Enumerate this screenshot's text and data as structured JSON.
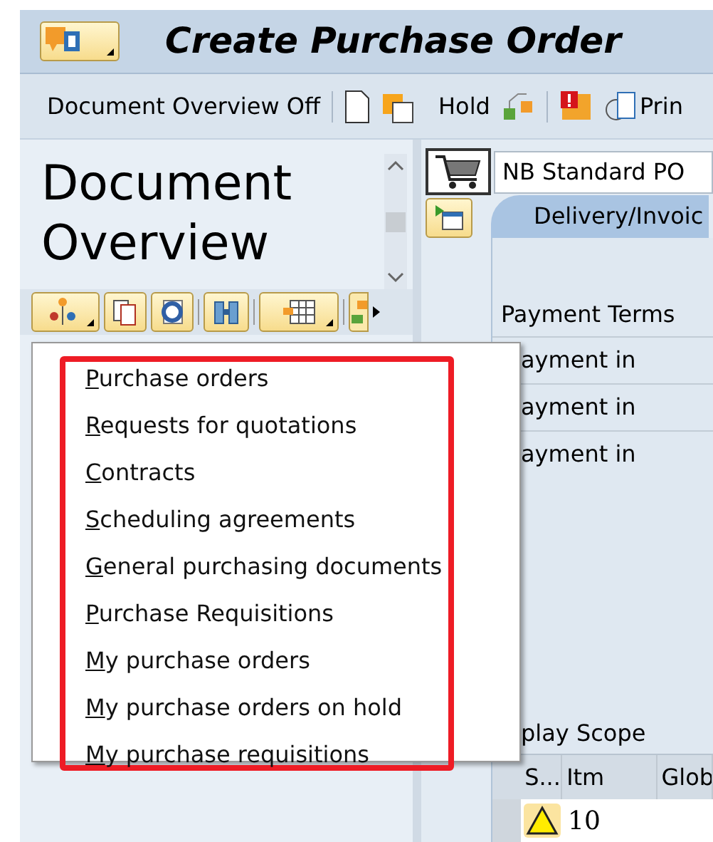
{
  "window": {
    "title": "Create Purchase Order"
  },
  "toolbar": {
    "labels": [
      "Document Overview Off",
      "Hold",
      "Prin"
    ]
  },
  "left_panel": {
    "title": "Document Overview"
  },
  "menu": {
    "items": [
      {
        "label": "Purchase orders"
      },
      {
        "label": "Requests for quotations"
      },
      {
        "label": "Contracts"
      },
      {
        "label": "Scheduling agreements"
      },
      {
        "label": "General purchasing documents"
      },
      {
        "label": "Purchase Requisitions"
      },
      {
        "label": "My purchase orders"
      },
      {
        "label": "My purchase orders on hold"
      },
      {
        "label": "My purchase requisitions"
      }
    ]
  },
  "right_panel": {
    "order_type": "NB Standard PO",
    "tabs": [
      {
        "label": "Delivery/Invoic",
        "selected": true
      }
    ],
    "payment_terms_label": "Payment Terms",
    "payment_rows": [
      "ayment in",
      "ayment in",
      "ayment in"
    ],
    "display_scope": "play Scope",
    "table": {
      "columns": [
        "S...",
        "Itm",
        "Glob"
      ],
      "rows": [
        {
          "item": "10"
        }
      ]
    }
  }
}
